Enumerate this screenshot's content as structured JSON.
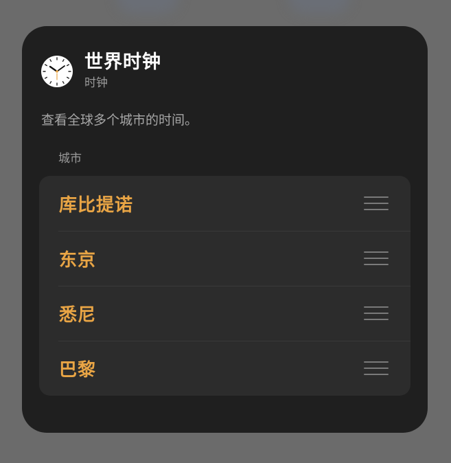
{
  "widget": {
    "title": "世界时钟",
    "app_name": "时钟",
    "description": "查看全球多个城市的时间。",
    "icon": "clock-icon"
  },
  "cities": {
    "section_label": "城市",
    "items": [
      {
        "name": "库比提诺"
      },
      {
        "name": "东京"
      },
      {
        "name": "悉尼"
      },
      {
        "name": "巴黎"
      }
    ]
  },
  "colors": {
    "panel_background": "#1f1f1f",
    "list_background": "#2c2c2c",
    "city_accent": "#e9a545",
    "backdrop": "#6b6b6b"
  }
}
